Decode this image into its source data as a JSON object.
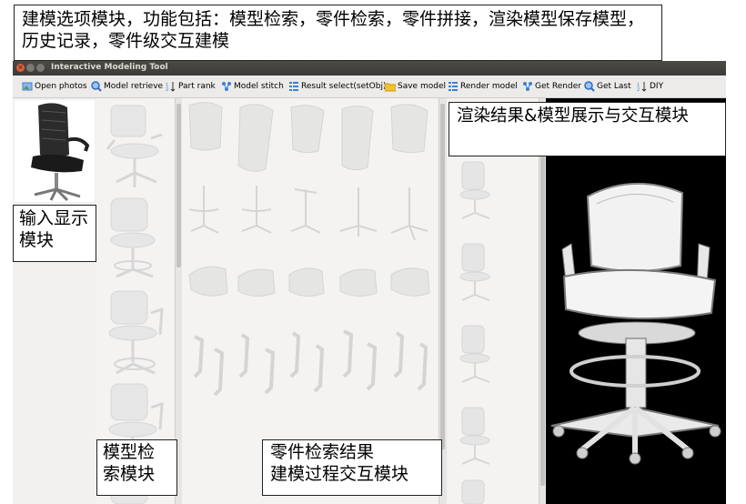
{
  "window": {
    "title": "Interactive Modeling Tool",
    "close_glyph": "×"
  },
  "toolbar": [
    {
      "label": "Open photos",
      "icon": "image-icon"
    },
    {
      "label": "Model retrieve",
      "icon": "search-icon"
    },
    {
      "label": "Part rank",
      "icon": "sort-icon"
    },
    {
      "label": "Model stitch",
      "icon": "nodes-icon"
    },
    {
      "label": "Result select(setObj)",
      "icon": "list-icon"
    },
    {
      "label": "Save model",
      "icon": "folder-icon"
    },
    {
      "label": "Render model",
      "icon": "list-icon"
    },
    {
      "label": "Get Render",
      "icon": "nodes-icon"
    },
    {
      "label": "Get Last",
      "icon": "search-icon"
    },
    {
      "label": "DIY",
      "icon": "sort-icon"
    }
  ],
  "callouts": {
    "top": "建模选项模块，功能包括：模型检索，零件检索，零件拼接，渲染模型保存模型，历史记录，零件级交互建模",
    "render": "渲染结果&模型展示与交互模块",
    "input": "输入显示模块",
    "model": "模型检索模块",
    "parts_line1": "零件检索结果",
    "parts_line2": "建模过程交互模块"
  },
  "colors": {
    "accent_blue": "#3f7fd6",
    "folder_yellow": "#f2c12e",
    "close_red": "#e25e35",
    "render_background": "#000000"
  }
}
